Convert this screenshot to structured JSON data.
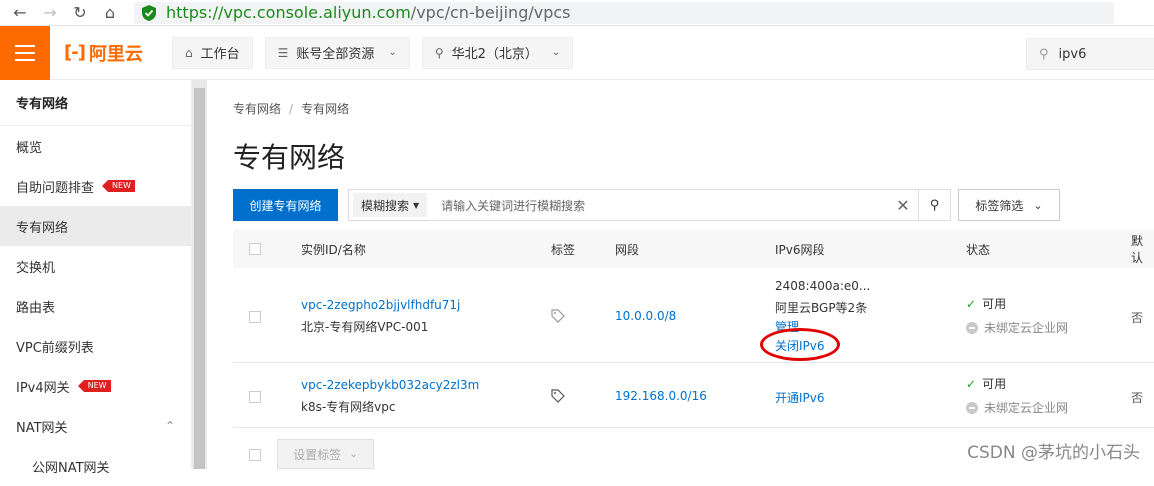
{
  "browser": {
    "url_scheme": "https://",
    "url_host": "vpc.console.aliyun.com",
    "url_path": "/vpc/cn-beijing/vpcs",
    "back_icon": "arrow-left-icon",
    "forward_icon": "arrow-right-icon",
    "reload_icon": "reload-icon",
    "home_icon": "home-icon",
    "lock_icon": "shield-check-icon",
    "secure_color": "#1a8a1a"
  },
  "topbar": {
    "brand_color": "#ff6a00",
    "logo_mark": "[-]",
    "logo_text": "阿里云",
    "workbench": "工作台",
    "resources": "账号全部资源",
    "region": "华北2（北京）",
    "search_value": "ipv6"
  },
  "sidebar": {
    "title": "专有网络",
    "items": [
      {
        "label": "概览",
        "new": false,
        "active": false
      },
      {
        "label": "自助问题排查",
        "new": true,
        "active": false
      },
      {
        "label": "专有网络",
        "new": false,
        "active": true
      },
      {
        "label": "交换机",
        "new": false,
        "active": false
      },
      {
        "label": "路由表",
        "new": false,
        "active": false
      },
      {
        "label": "VPC前缀列表",
        "new": false,
        "active": false
      },
      {
        "label": "IPv4网关",
        "new": true,
        "active": false
      },
      {
        "label": "NAT网关",
        "new": false,
        "active": false,
        "expandable": true
      },
      {
        "label": "公网NAT网关",
        "new": false,
        "active": false
      }
    ],
    "new_badge": "NEW"
  },
  "main": {
    "breadcrumb": [
      "专有网络",
      "专有网络"
    ],
    "page_title": "专有网络",
    "create_button": "创建专有网络",
    "search_type": "模糊搜索",
    "search_placeholder": "请输入关键词进行模糊搜索",
    "tag_filter": "标签筛选",
    "columns": [
      "实例ID/名称",
      "标签",
      "网段",
      "IPv6网段",
      "状态",
      "默认"
    ],
    "rows": [
      {
        "id": "vpc-2zegpho2bjjvlfhdfu71j",
        "name": "北京-专有网络VPC-001",
        "cidr": "10.0.0.0/8",
        "ipv6_cidr": "2408:400a:e0...",
        "ipv6_desc": "阿里云BGP等2条",
        "ipv6_manage": "管理",
        "ipv6_action": "关闭IPv6",
        "status": "可用",
        "cen": "未绑定云企业网",
        "default": "否"
      },
      {
        "id": "vpc-2zekepbykb032acy2zl3m",
        "name": "k8s-专有网络vpc",
        "cidr": "192.168.0.0/16",
        "ipv6_action": "开通IPv6",
        "status": "可用",
        "cen": "未绑定云企业网",
        "default": "否"
      }
    ],
    "set_tags_button": "设置标签",
    "accent_color": "#0070cc",
    "highlight_color": "#e00000"
  },
  "watermark": "CSDN @茅坑的小石头"
}
